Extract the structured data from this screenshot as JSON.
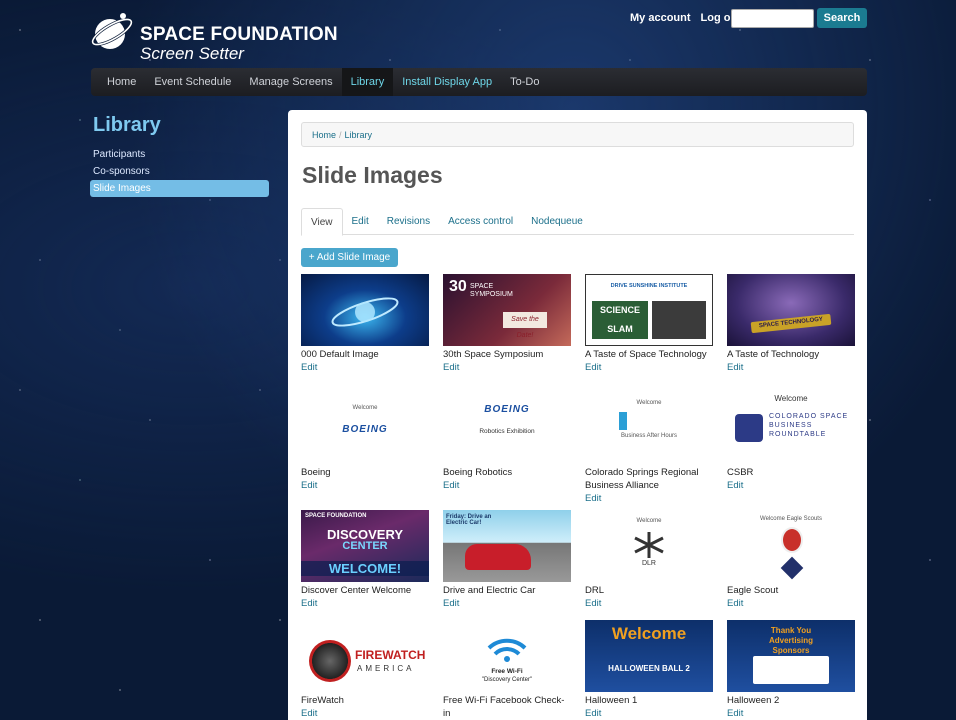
{
  "header": {
    "brand_title": "SPACE FOUNDATION",
    "brand_subtitle": "Screen Setter",
    "my_account": "My account",
    "log_out": "Log out",
    "search_value": "",
    "search_button": "Search"
  },
  "nav": {
    "items": [
      "Home",
      "Event Schedule",
      "Manage Screens",
      "Library",
      "Install Display App",
      "To-Do"
    ],
    "active": "Library"
  },
  "sidebar": {
    "title": "Library",
    "items": [
      "Participants",
      "Co-sponsors",
      "Slide Images"
    ],
    "active": "Slide Images"
  },
  "breadcrumb": {
    "home": "Home",
    "current": "Library",
    "separator": "/"
  },
  "page_title": "Slide Images",
  "tabs": [
    "View",
    "Edit",
    "Revisions",
    "Access control",
    "Nodequeue"
  ],
  "add_button": "+ Add Slide Image",
  "edit_label": "Edit",
  "thumb_text": {
    "symposium_num": "30",
    "symposium_word": "SPACE SYMPOSIUM",
    "save_date": "Save the Date!",
    "drive_sunshine": "DRIVE SUNSHINE INSTITUTE",
    "science_slam": "SCIENCE SLAM",
    "space_tech": "SPACE TECHNOLOGY",
    "welcome": "Welcome",
    "boeing": "BOEING",
    "robotics_exhibition": "Robotics Exhibition",
    "business_after_hours": "Business After Hours",
    "csbr_logo": "COLORADO SPACE BUSINESS ROUNDTABLE",
    "space_foundation": "SPACE FOUNDATION",
    "discovery": "DISCOVERY",
    "center": "CENTER",
    "welcome_big": "WELCOME!",
    "drive_electric": "Friday: Drive an Electric Car!",
    "dlr": "DLR",
    "welcome_scouts": "Welcome Eagle Scouts",
    "firewatch": "FIREWATCH",
    "america": "AMERICA",
    "free_wifi": "Free Wi-Fi",
    "discovery_center_quote": "\"Discovery Center\"",
    "halloween_welcome": "Welcome",
    "halloween_ball": "HALLOWEEN BALL 2",
    "thank_you": "Thank You Advertising Sponsors"
  },
  "images": [
    {
      "title": "000 Default Image"
    },
    {
      "title": "30th Space Symposium"
    },
    {
      "title": "A Taste of Space Technology"
    },
    {
      "title": "A Taste of Technology"
    },
    {
      "title": "Boeing"
    },
    {
      "title": "Boeing Robotics"
    },
    {
      "title": "Colorado Springs Regional Business Alliance"
    },
    {
      "title": "CSBR"
    },
    {
      "title": "Discover Center Welcome"
    },
    {
      "title": "Drive and Electric Car"
    },
    {
      "title": "DRL"
    },
    {
      "title": "Eagle Scout"
    },
    {
      "title": "FireWatch"
    },
    {
      "title": "Free Wi-Fi Facebook Check-in"
    },
    {
      "title": "Halloween 1"
    },
    {
      "title": "Halloween 2"
    }
  ],
  "colors": {
    "accent": "#1b7b91",
    "link": "#1b6f8a",
    "sidebar_active": "#74bde6",
    "nav_active_text": "#6ed6e8"
  }
}
